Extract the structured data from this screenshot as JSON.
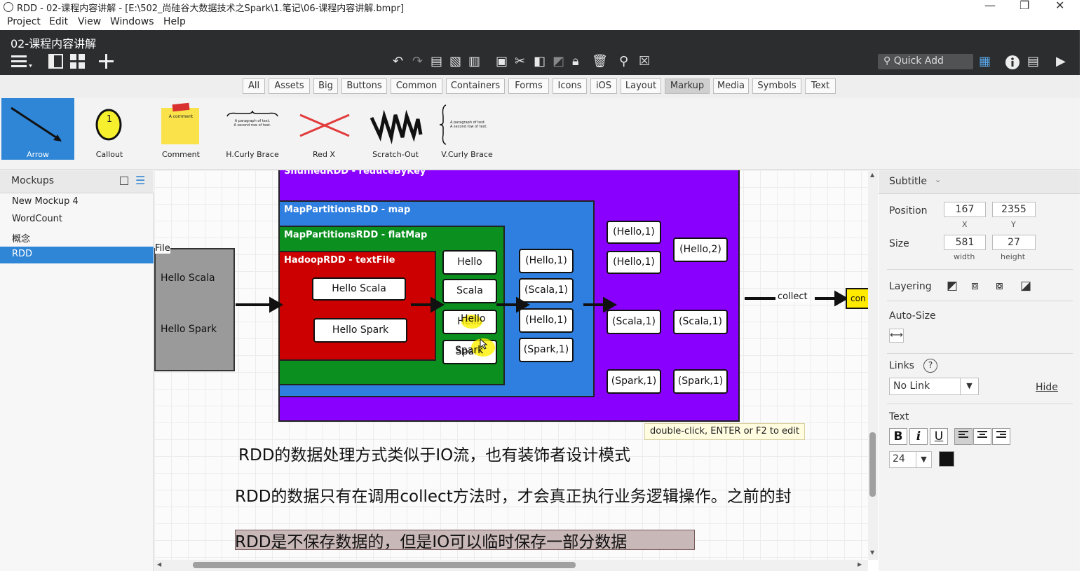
{
  "window": {
    "title": "RDD - 02-课程内容讲解 - [E:\\502_尚硅谷大数据技术之Spark\\1.笔记\\06-课程内容讲解.bmpr]",
    "minimize": "—",
    "restore": "❐",
    "close": "✕"
  },
  "menu": [
    "Project",
    "Edit",
    "View",
    "Windows",
    "Help"
  ],
  "header": {
    "doc_title": "02-课程内容讲解",
    "quick_add": "Quick Add"
  },
  "library_tabs": [
    "All",
    "Assets",
    "Big",
    "Buttons",
    "Common",
    "Containers",
    "Forms",
    "Icons",
    "iOS",
    "Layout",
    "Markup",
    "Media",
    "Symbols",
    "Text"
  ],
  "library_selected_tab": "Markup",
  "library_items": [
    "Arrow",
    "Callout",
    "Comment",
    "H.Curly Brace",
    "Red X",
    "Scratch-Out",
    "V.Curly Brace"
  ],
  "library_selected_item": "Arrow",
  "library_previews": {
    "callout_number": "1",
    "comment_text": "A comment",
    "hcurly_lines": [
      "A paragraph of text.",
      "A second row of text."
    ],
    "vcurly_lines": [
      "A paragraph of text.",
      "A second row of text."
    ]
  },
  "mockups": {
    "header": "Mockups",
    "items": [
      "New Mockup 4",
      "WordCount",
      "概念",
      "RDD"
    ],
    "selected": "RDD"
  },
  "canvas": {
    "file_label": "File",
    "file_lines": [
      "Hello Scala",
      "Hello Spark"
    ],
    "shuffled_label": "ShuffledRDD - reduceByKey",
    "map_label": "MapPartitionsRDD - map",
    "flatmap_label": "MapPartitionsRDD - flatMap",
    "hadoop_label": "HadoopRDD - textFile",
    "hadoop_lines": [
      "Hello Scala",
      "Hello Spark"
    ],
    "words": [
      "Hello",
      "Scala",
      "Hello",
      "Spark"
    ],
    "map_pairs": [
      "(Hello,1)",
      "(Scala,1)",
      "(Hello,1)",
      "(Spark,1)"
    ],
    "shuffle_left": [
      "(Hello,1)",
      "(Hello,1)",
      "(Scala,1)",
      "(Spark,1)"
    ],
    "shuffle_right": [
      "(Hello,2)",
      "(Scala,1)",
      "(Spark,1)"
    ],
    "collect_label": "collect",
    "console_label": "con",
    "tooltip": "double-click, ENTER or F2 to edit",
    "notes": [
      "RDD的数据处理方式类似于IO流，也有装饰者设计模式",
      "RDD的数据只有在调用collect方法时，才会真正执行业务逻辑操作。之前的封",
      "RDD是不保存数据的，但是IO可以临时保存一部分数据"
    ]
  },
  "properties": {
    "title": "Subtitle",
    "position_label": "Position",
    "x": "167",
    "y": "2355",
    "x_caption": "X",
    "y_caption": "Y",
    "size_label": "Size",
    "width": "581",
    "height": "27",
    "width_caption": "width",
    "height_caption": "height",
    "layering_label": "Layering",
    "autosize_label": "Auto-Size",
    "links_label": "Links",
    "help": "?",
    "link_value": "No Link",
    "hide_label": "Hide",
    "text_label": "Text",
    "bold": "B",
    "italic": "i",
    "underline": "U",
    "font_size": "24"
  },
  "colors": {
    "shuffled": "#8a00ff",
    "map": "#2f7fe0",
    "flatmap": "#0b8f1f",
    "hadoop": "#cc0000",
    "file_box": "#9a9a9a",
    "selection_blue": "#2f86d6",
    "dark_header": "#2b2d2f",
    "console_yellow": "#ffea00"
  }
}
